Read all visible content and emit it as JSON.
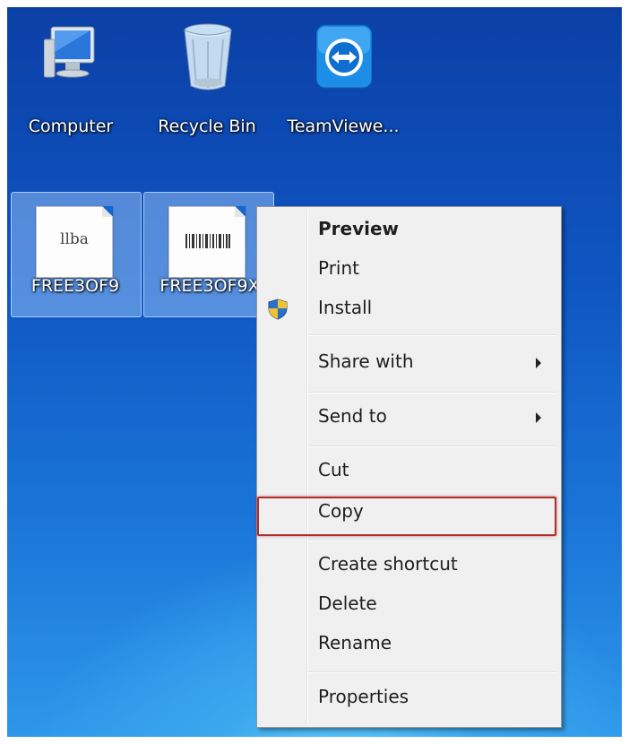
{
  "desktop": {
    "icons": [
      {
        "name": "computer",
        "label": "Computer"
      },
      {
        "name": "recycle-bin",
        "label": "Recycle Bin"
      },
      {
        "name": "teamviewer",
        "label": "TeamViewe..."
      }
    ],
    "files": [
      {
        "label": "FREE3OF9",
        "preview": "llba"
      },
      {
        "label": "FREE3OF9X",
        "preview": "barcode"
      }
    ]
  },
  "context_menu": {
    "items": [
      {
        "label": "Preview",
        "bold": true
      },
      {
        "label": "Print"
      },
      {
        "label": "Install",
        "icon": "uac-shield-icon"
      },
      {
        "label": "Share with",
        "submenu": true
      },
      {
        "label": "Send to",
        "submenu": true
      },
      {
        "label": "Cut"
      },
      {
        "label": "Copy",
        "highlighted": true
      },
      {
        "label": "Create shortcut"
      },
      {
        "label": "Delete"
      },
      {
        "label": "Rename"
      },
      {
        "label": "Properties"
      }
    ],
    "highlight_color": "#b22a2a"
  }
}
